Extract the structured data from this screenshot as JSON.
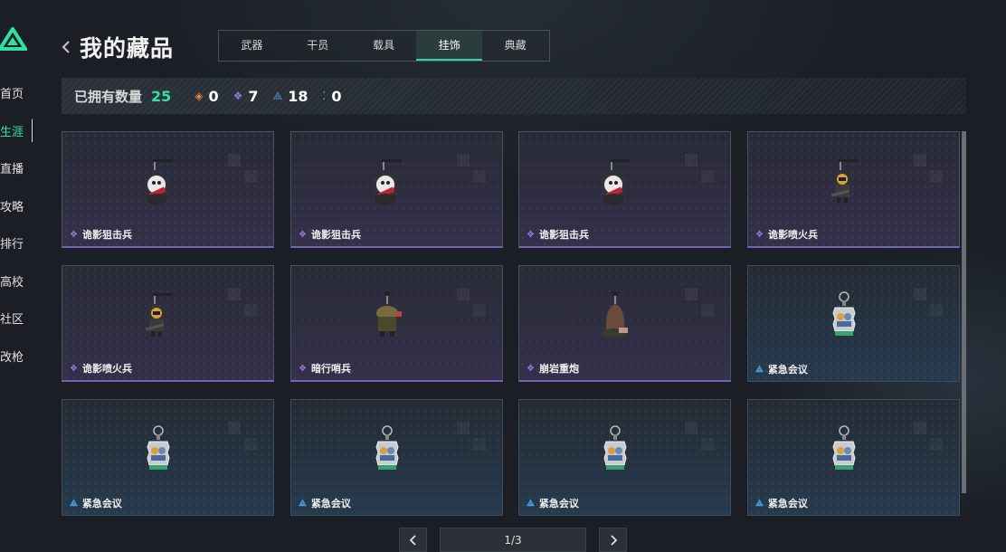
{
  "sidebar": {
    "items": [
      {
        "label": "首页",
        "active": false
      },
      {
        "label": "生涯",
        "active": true
      },
      {
        "label": "直播",
        "active": false
      },
      {
        "label": "攻略",
        "active": false
      },
      {
        "label": "排行",
        "active": false
      },
      {
        "label": "高校",
        "active": false
      },
      {
        "label": "社区",
        "active": false
      },
      {
        "label": "改枪",
        "active": false
      }
    ]
  },
  "header": {
    "title": "我的藏品",
    "tabs": [
      {
        "label": "武器"
      },
      {
        "label": "干员"
      },
      {
        "label": "载具"
      },
      {
        "label": "挂饰",
        "active": true
      },
      {
        "label": "典藏"
      }
    ]
  },
  "summary": {
    "owned_label": "已拥有数量",
    "owned_count": "25",
    "rarity_counts": [
      {
        "icon": "orange-diamond-icon",
        "color": "#e08a3c",
        "count": "0"
      },
      {
        "icon": "purple-diamond-icon",
        "color": "#9a78e0",
        "count": "7"
      },
      {
        "icon": "blue-diamond-icon",
        "color": "#4aa0e0",
        "count": "18"
      },
      {
        "icon": "teal-dots-icon",
        "color": "#2fd6a0",
        "count": "0"
      }
    ]
  },
  "items": [
    {
      "name": "诡影狙击兵",
      "rarity": "purple",
      "charm": "sniper"
    },
    {
      "name": "诡影狙击兵",
      "rarity": "purple",
      "charm": "sniper"
    },
    {
      "name": "诡影狙击兵",
      "rarity": "purple",
      "charm": "sniper"
    },
    {
      "name": "诡影喷火兵",
      "rarity": "purple",
      "charm": "flamer"
    },
    {
      "name": "诡影喷火兵",
      "rarity": "purple",
      "charm": "flamer"
    },
    {
      "name": "暗行哨兵",
      "rarity": "purple",
      "charm": "sentry"
    },
    {
      "name": "崩岩重炮",
      "rarity": "purple",
      "charm": "cannon"
    },
    {
      "name": "紧急会议",
      "rarity": "blue",
      "charm": "meeting"
    },
    {
      "name": "紧急会议",
      "rarity": "blue",
      "charm": "meeting"
    },
    {
      "name": "紧急会议",
      "rarity": "blue",
      "charm": "meeting"
    },
    {
      "name": "紧急会议",
      "rarity": "blue",
      "charm": "meeting"
    },
    {
      "name": "紧急会议",
      "rarity": "blue",
      "charm": "meeting"
    }
  ],
  "pagination": {
    "label": "1/3",
    "prev_icon": "chevron-left-icon",
    "next_icon": "chevron-right-icon"
  },
  "colors": {
    "accent": "#2fe0a0",
    "purple_rarity": "#7a62b8",
    "blue_rarity": "#4aa0e0"
  }
}
